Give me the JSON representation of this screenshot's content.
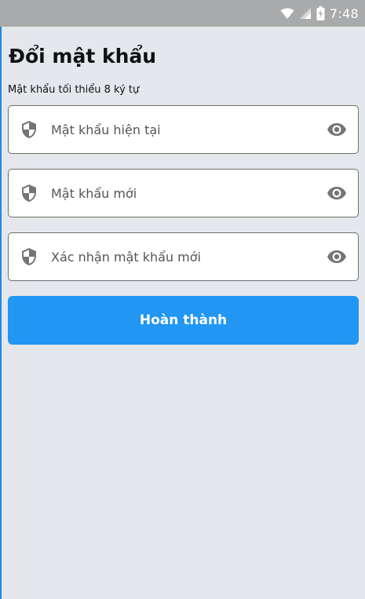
{
  "status_bar": {
    "time": "7:48",
    "icons": [
      "wifi-icon",
      "cellular-signal-icon",
      "battery-charging-icon"
    ]
  },
  "page": {
    "title": "Đổi mật khẩu",
    "subtitle": "Mật khẩu tối thiểu 8 ký tự"
  },
  "form": {
    "current_password": {
      "placeholder": "Mật khẩu hiện tại",
      "value": "",
      "lead_icon": "shield-icon",
      "trail_icon": "eye-icon"
    },
    "new_password": {
      "placeholder": "Mật khẩu mới",
      "value": "",
      "lead_icon": "shield-icon",
      "trail_icon": "eye-icon"
    },
    "confirm_password": {
      "placeholder": "Xác nhận mật khẩu mới",
      "value": "",
      "lead_icon": "shield-icon",
      "trail_icon": "eye-icon"
    },
    "submit_label": "Hoàn thành"
  },
  "colors": {
    "primary": "#2196f3",
    "background": "#e4e7ec",
    "status_bar": "#a9aaab",
    "icon_gray": "#757575"
  }
}
